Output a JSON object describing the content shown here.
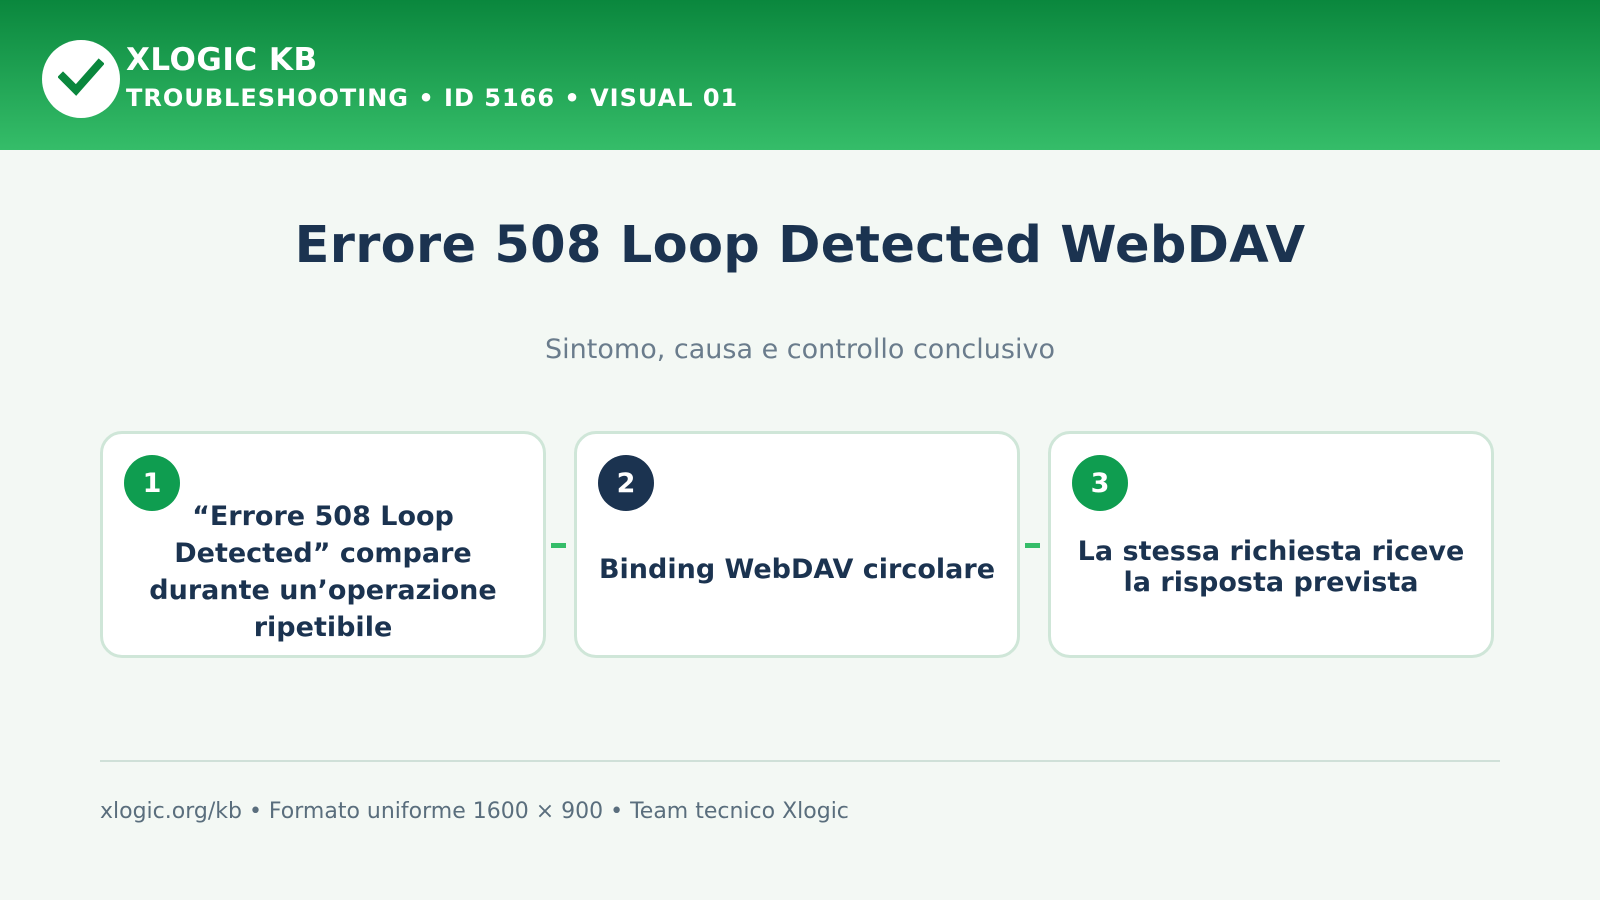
{
  "header": {
    "brand": "XLOGIC KB",
    "subline": "TROUBLESHOOTING • ID 5166 • VISUAL 01",
    "logo_icon": "check-icon"
  },
  "main": {
    "title": "Errore 508 Loop Detected WebDAV",
    "subtitle": "Sintomo, causa e controllo conclusivo"
  },
  "steps": [
    {
      "number": "1",
      "text": "“Errore 508 Loop Detected” compare durante un’operazione ripetibile",
      "badge_color": "#0f9d50"
    },
    {
      "number": "2",
      "text": "Binding WebDAV circolare",
      "badge_color": "#1b3350"
    },
    {
      "number": "3",
      "text": "La stessa richiesta riceve la risposta prevista",
      "badge_color": "#0f9d50"
    }
  ],
  "footer": {
    "text": "xlogic.org/kb • Formato uniforme 1600 × 900 • Team tecnico Xlogic"
  },
  "colors": {
    "header_start": "#0a873d",
    "header_end": "#35bd69",
    "title": "#1b3350",
    "connector": "#35bd69"
  }
}
